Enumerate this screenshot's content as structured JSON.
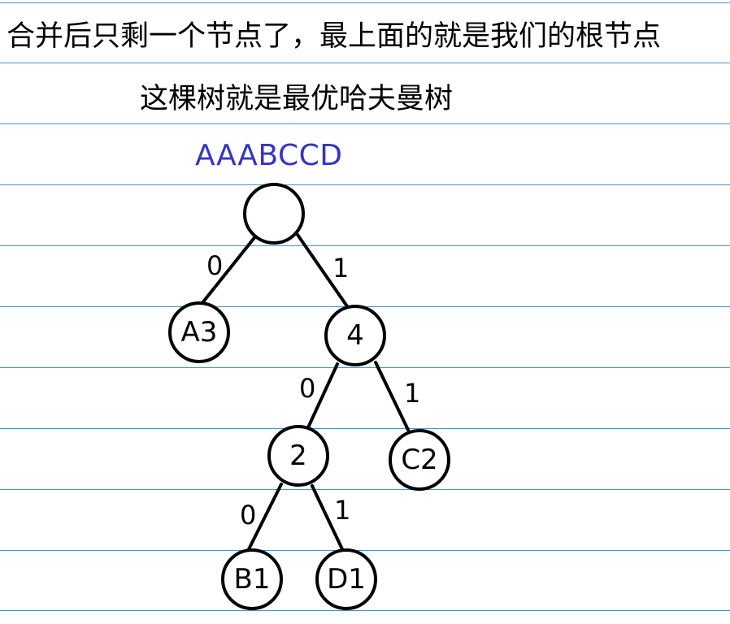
{
  "captions": {
    "line1": "合并后只剩一个节点了，最上面的就是我们的根节点",
    "line2": "这棵树就是最优哈夫曼树"
  },
  "source_string": "AAABCCD",
  "tree": {
    "root": "",
    "nodes": {
      "a3": "A3",
      "n4": "4",
      "n2": "2",
      "c2": "C2",
      "b1": "B1",
      "d1": "D1"
    },
    "edge_labels": {
      "root_a3": "0",
      "root_n4": "1",
      "n4_n2": "0",
      "n4_c2": "1",
      "n2_b1": "0",
      "n2_d1": "1"
    }
  },
  "colors": {
    "rule_lines": "#3a97d6",
    "source_string": "#3535c2",
    "ink": "#000000"
  }
}
